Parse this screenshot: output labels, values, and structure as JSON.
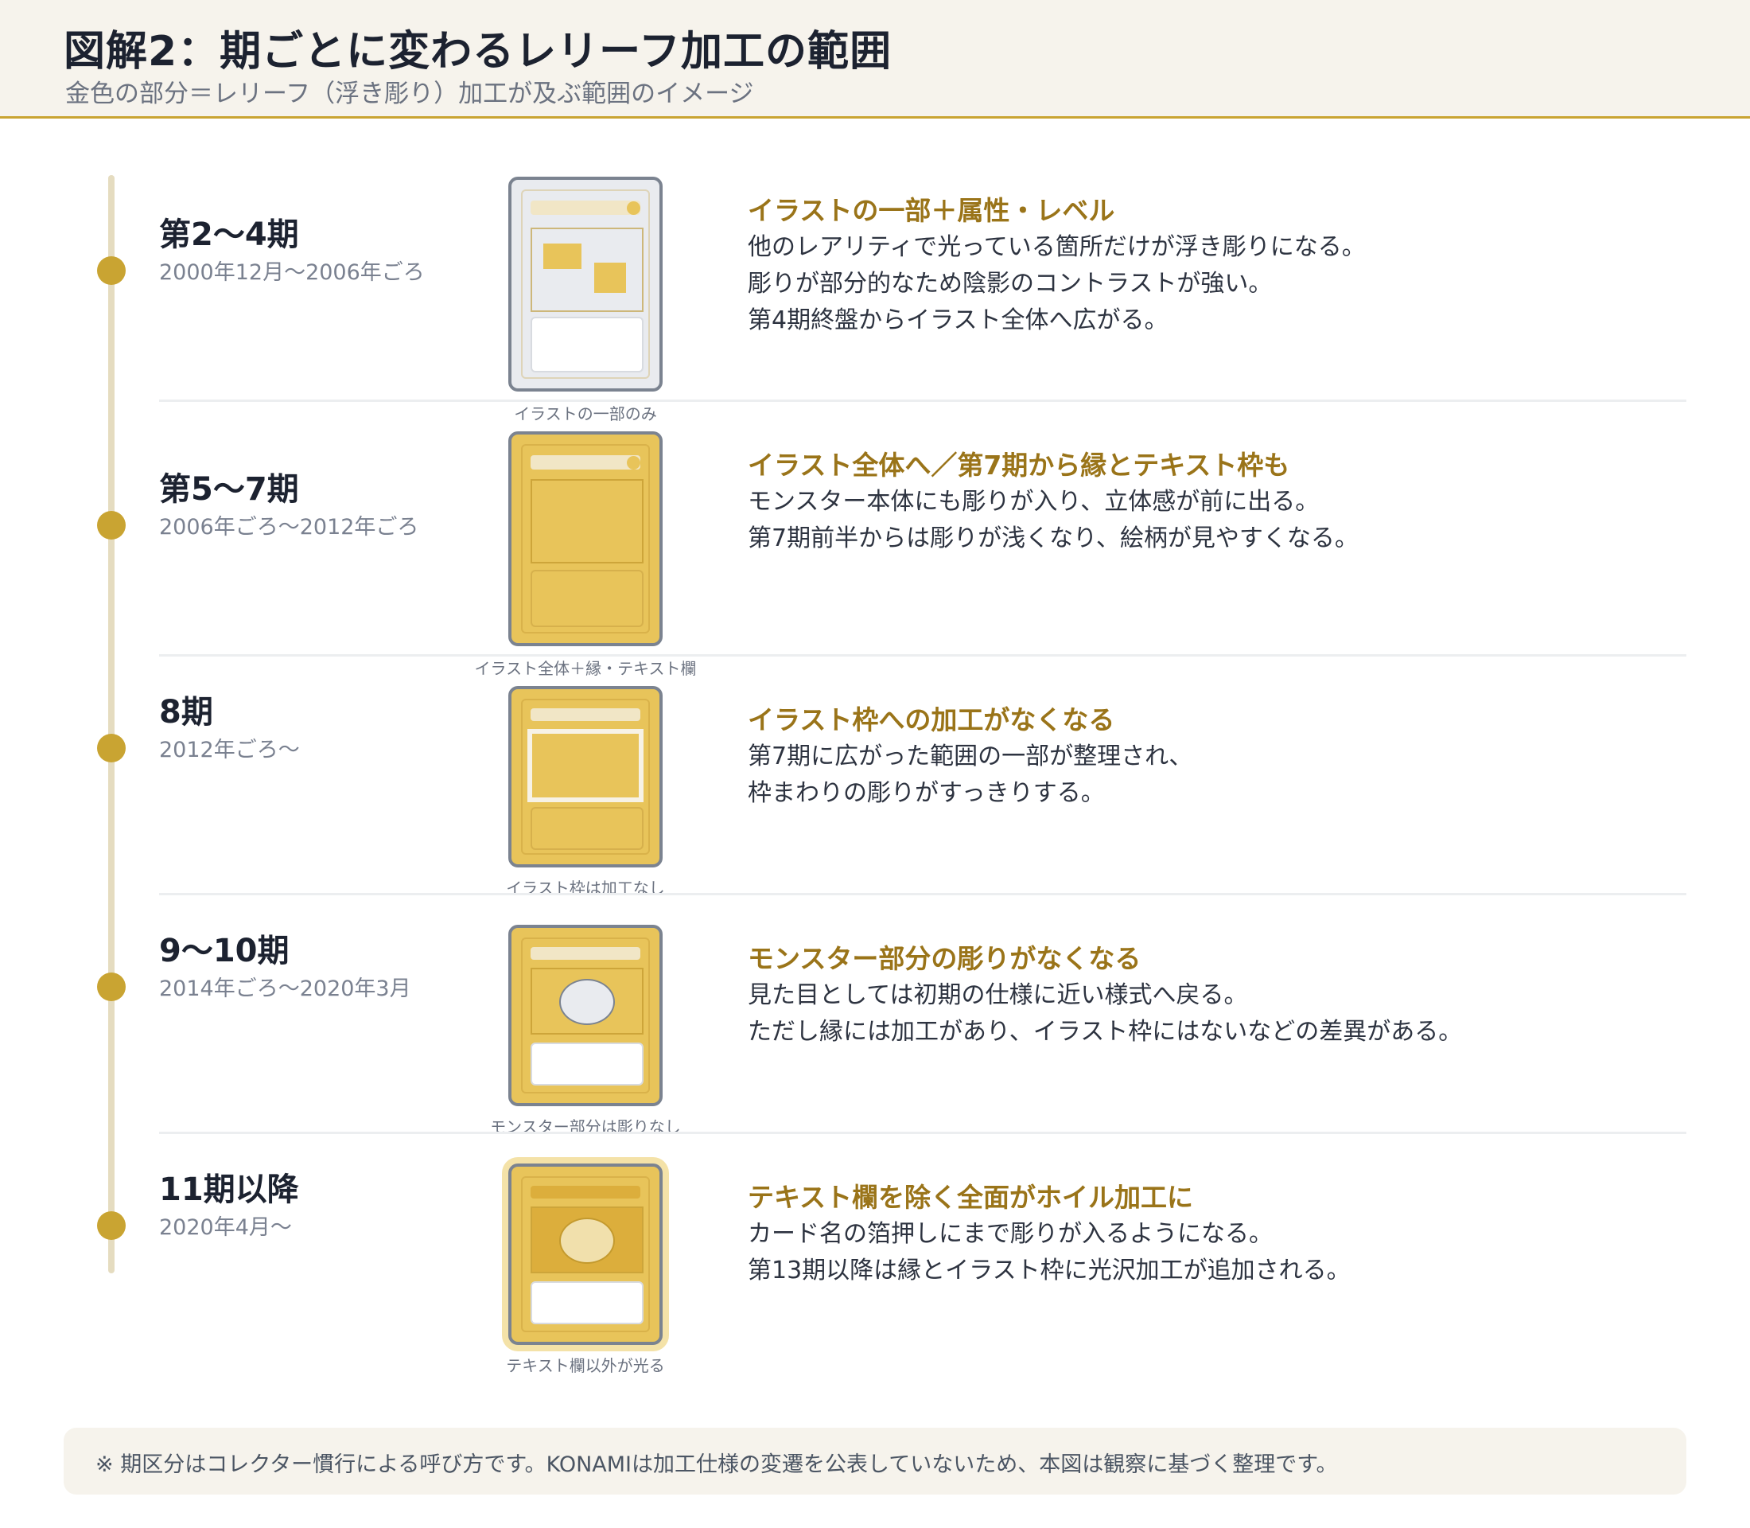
{
  "header": {
    "title": "図解2：期ごとに変わるレリーフ加工の範囲",
    "subtitle": "金色の部分＝レリーフ（浮き彫り）加工が及ぶ範囲のイメージ"
  },
  "colors": {
    "gold": "#c9a432",
    "gold_fill": "#e8c45a",
    "heading": "#9a7419",
    "card_pale": "#e9ebef",
    "header_bg": "#f6f3ec"
  },
  "periods": [
    {
      "name": "第2〜4期",
      "date": "2000年12月〜2006年ごろ",
      "caption": "イラストの一部のみ",
      "heading": "イラストの一部＋属性・レベル",
      "lines": [
        "他のレアリティで光っている箇所だけが浮き彫りになる。",
        "彫りが部分的なため陰影のコントラストが強い。",
        "第4期終盤からイラスト全体へ広がる。"
      ]
    },
    {
      "name": "第5〜7期",
      "date": "2006年ごろ〜2012年ごろ",
      "caption": "イラスト全体＋縁・テキスト欄",
      "heading": "イラスト全体へ／第7期から縁とテキスト枠も",
      "lines": [
        "モンスター本体にも彫りが入り、立体感が前に出る。",
        "第7期前半からは彫りが浅くなり、絵柄が見やすくなる。"
      ]
    },
    {
      "name": "8期",
      "date": "2012年ごろ〜",
      "caption": "イラスト枠は加工なし",
      "heading": "イラスト枠への加工がなくなる",
      "lines": [
        "第7期に広がった範囲の一部が整理され、",
        "枠まわりの彫りがすっきりする。"
      ]
    },
    {
      "name": "9〜10期",
      "date": "2014年ごろ〜2020年3月",
      "caption": "モンスター部分は彫りなし",
      "heading": "モンスター部分の彫りがなくなる",
      "lines": [
        "見た目としては初期の仕様に近い様式へ戻る。",
        "ただし縁には加工があり、イラスト枠にはないなどの差異がある。"
      ]
    },
    {
      "name": "11期以降",
      "date": "2020年4月〜",
      "caption": "テキスト欄以外が光る",
      "heading": "テキスト欄を除く全面がホイル加工に",
      "lines": [
        "カード名の箔押しにまで彫りが入るようになる。",
        "第13期以降は縁とイラスト枠に光沢加工が追加される。"
      ]
    }
  ],
  "note": {
    "text": "※ 期区分はコレクター慣行による呼び方です。KONAMIは加工仕様の変遷を公表していないため、本図は観察に基づく整理です。"
  }
}
